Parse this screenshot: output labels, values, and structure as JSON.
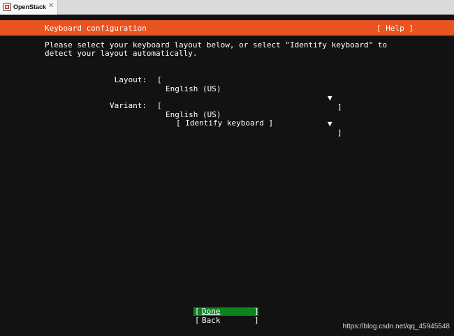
{
  "browser": {
    "tab_title": "OpenStack",
    "tab_close": "✕"
  },
  "screen": {
    "header_title": "Keyboard configuration",
    "help_button": "[ Help ]",
    "intro_line1": "Please select your keyboard layout below, or select \"Identify keyboard\" to",
    "intro_line2": "detect your layout automatically.",
    "layout_label": "Layout:",
    "layout_value": "English (US)",
    "variant_label": "Variant:",
    "variant_value": "English (US)",
    "identify_button": "[ Identify keyboard ]",
    "done_button": "Done",
    "back_button": "Back"
  },
  "watermark": "https://blog.csdn.net/qq_45945548",
  "colors": {
    "header": "#e95420",
    "done_highlight": "#0e8420",
    "background": "#121212"
  }
}
